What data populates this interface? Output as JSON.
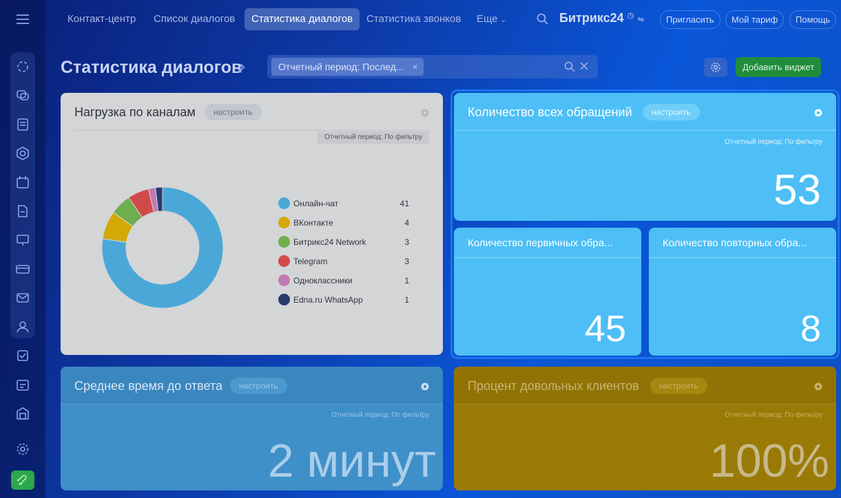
{
  "topbar": {
    "tabs": [
      "Контакт-центр",
      "Список диалогов",
      "Статистика диалогов",
      "Статистика звонков",
      "Еще"
    ],
    "active_tab": "Статистика диалогов",
    "brand": "Битрикс",
    "brand_suffix": "24",
    "buttons": {
      "invite": "Пригласить",
      "tariff": "Мой тариф",
      "help": "Помощь"
    }
  },
  "page": {
    "title": "Статистика диалогов",
    "filter_chip": "Отчетный период: Послед...",
    "add_widget": "Добавить виджет"
  },
  "widgets": {
    "load": {
      "title": "Нагрузка по каналам",
      "configure": "настроить",
      "period": "Отчетный период: По фильтру"
    },
    "all": {
      "title": "Количество всех обращений",
      "configure": "настроить",
      "period": "Отчетный период: По фильтру",
      "value": "53"
    },
    "first": {
      "title": "Количество первичных обра...",
      "value": "45"
    },
    "repeat": {
      "title": "Количество повторных обра...",
      "value": "8"
    },
    "time": {
      "title": "Среднее время до ответа",
      "configure": "настроить",
      "period": "Отчетный период: По фильтру",
      "value": "2 минут"
    },
    "happy": {
      "title": "Процент довольных клиентов",
      "configure": "настроить",
      "period": "Отчетный период: По фильтру",
      "value": "100%"
    }
  },
  "chart_data": {
    "type": "pie",
    "categories": [
      "Онлайн-чат",
      "ВКонтакте",
      "Битрикс24 Network",
      "Telegram",
      "Одноклассники",
      "Edna.ru WhatsApp"
    ],
    "values": [
      41,
      4,
      3,
      3,
      1,
      1
    ],
    "colors": [
      "#4aa8d8",
      "#d2a905",
      "#6eae4e",
      "#d14a4a",
      "#c27ab2",
      "#2a3a6e"
    ],
    "donut": true
  },
  "colors": {
    "accent_blue": "#4dbff6",
    "green_button": "#1f8d3c",
    "gold_widget": "#9a7a07"
  }
}
